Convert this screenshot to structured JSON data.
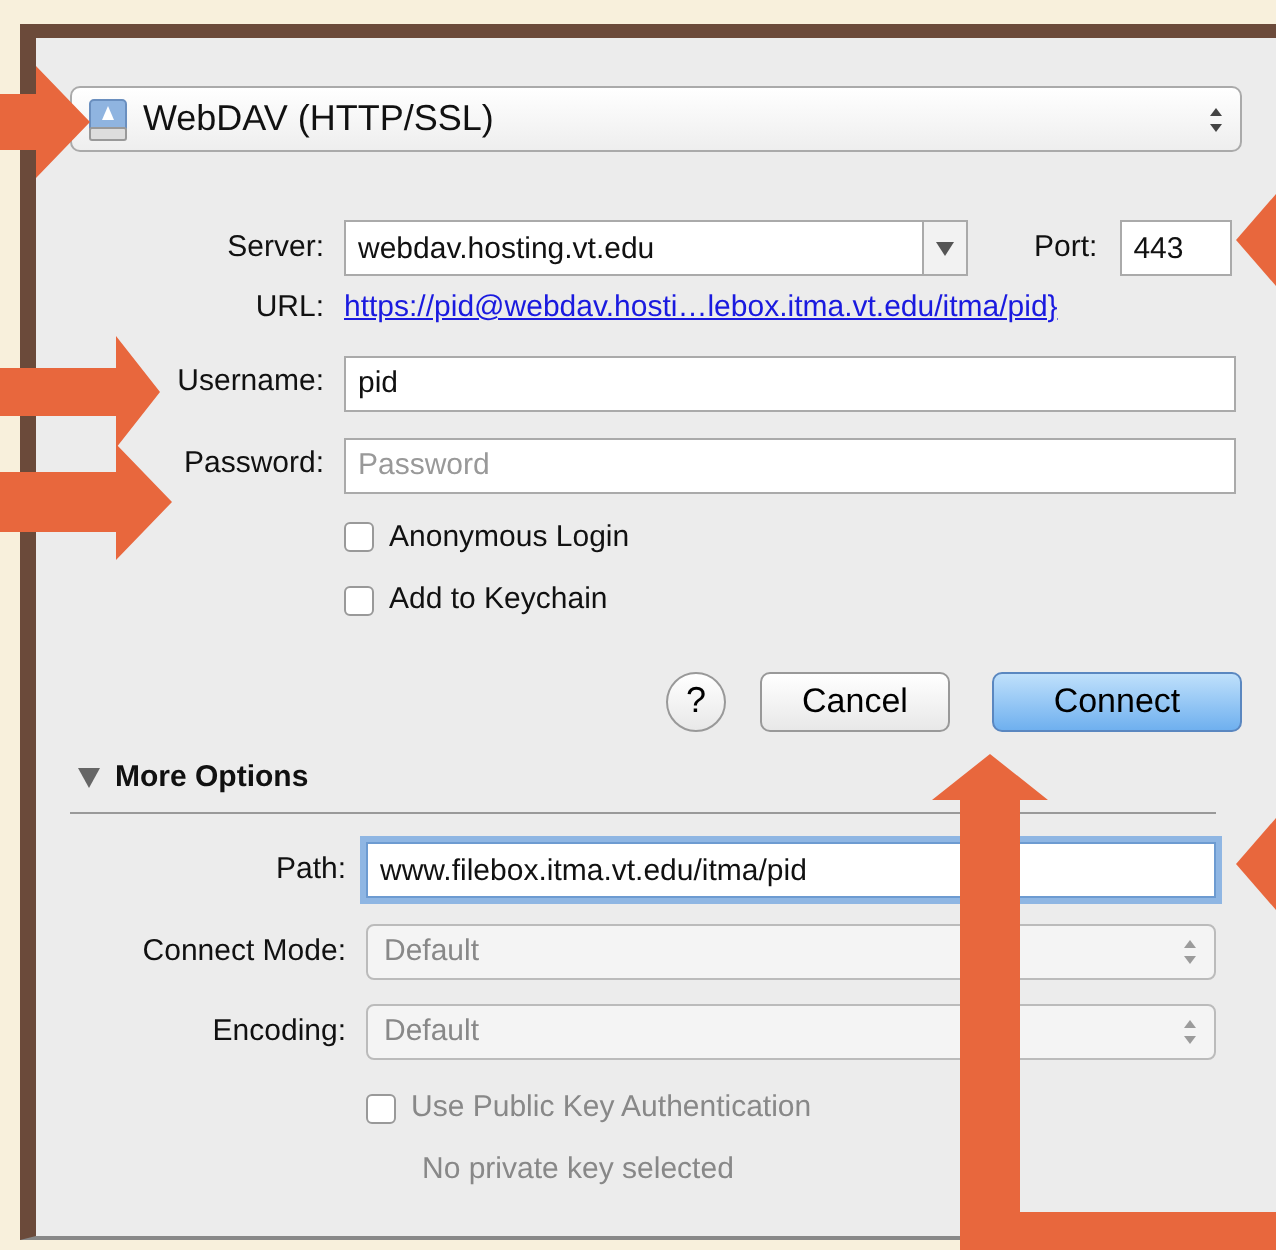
{
  "connection_type": {
    "value": "WebDAV (HTTP/SSL)"
  },
  "server": {
    "label": "Server:",
    "value": "webdav.hosting.vt.edu"
  },
  "port": {
    "label": "Port:",
    "value": "443"
  },
  "url": {
    "label": "URL:",
    "link": "https://pid@webdav.hosti…lebox.itma.vt.edu/itma/pid}"
  },
  "username": {
    "label": "Username:",
    "value": "pid"
  },
  "password": {
    "label": "Password:",
    "placeholder": "Password"
  },
  "options": [
    {
      "label": "Anonymous Login",
      "checked": false
    },
    {
      "label": "Add to Keychain",
      "checked": false
    }
  ],
  "buttons": [
    {
      "kind": "help",
      "label": "?"
    },
    {
      "kind": "cancel",
      "label": "Cancel"
    },
    {
      "kind": "default",
      "label": "Connect"
    }
  ],
  "more_options": {
    "label": "More Options",
    "expanded": true,
    "path": {
      "label": "Path:",
      "value": "www.filebox.itma.vt.edu/itma/pid",
      "focused": true
    },
    "connect_mode": {
      "label": "Connect Mode:",
      "value": "Default",
      "disabled": true
    },
    "encoding": {
      "label": "Encoding:",
      "value": "Default",
      "disabled": true
    },
    "public_key": {
      "label": "Use Public Key Authentication",
      "checked": false,
      "disabled": true
    },
    "key_status": "No private key selected"
  }
}
